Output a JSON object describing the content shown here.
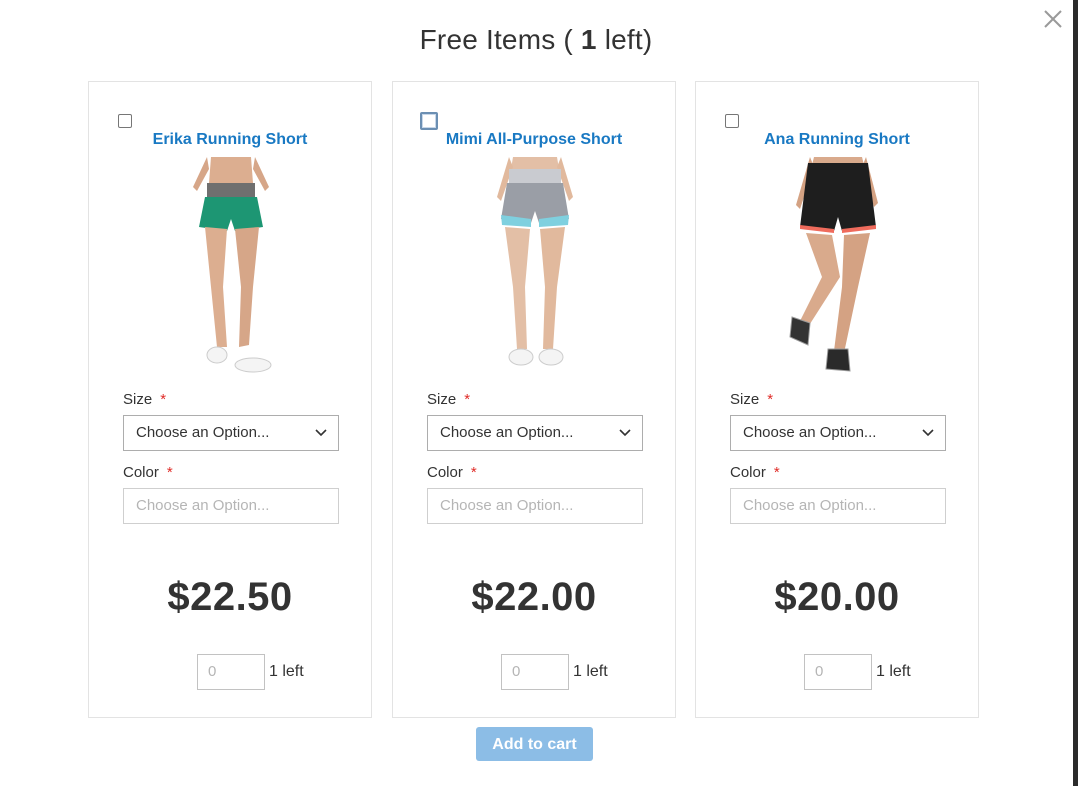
{
  "modal": {
    "title_prefix": "Free Items (",
    "title_count": "1",
    "title_suffix": "left)",
    "add_to_cart_label": "Add to cart"
  },
  "products": [
    {
      "name": "Erika Running Short",
      "size_label": "Size",
      "color_label": "Color",
      "required_marker": "*",
      "size_value": "Choose an Option...",
      "color_value": "Choose an Option...",
      "price": "$22.50",
      "qty_value": "0",
      "qty_left": "1 left",
      "shorts_color": "#1d9673"
    },
    {
      "name": "Mimi All-Purpose Short",
      "size_label": "Size",
      "color_label": "Color",
      "required_marker": "*",
      "size_value": "Choose an Option...",
      "color_value": "Choose an Option...",
      "price": "$22.00",
      "qty_value": "0",
      "qty_left": "1 left",
      "shorts_color": "#9a9ea6"
    },
    {
      "name": "Ana Running Short",
      "size_label": "Size",
      "color_label": "Color",
      "required_marker": "*",
      "size_value": "Choose an Option...",
      "color_value": "Choose an Option...",
      "price": "$20.00",
      "qty_value": "0",
      "qty_left": "1 left",
      "shorts_color": "#1e1e1e"
    }
  ],
  "colors": {
    "link": "#1979c3",
    "required": "#e02b27",
    "button": "#8cbde6"
  },
  "icons": {
    "close": "close-icon",
    "dropdown": "chevron-down-icon"
  }
}
